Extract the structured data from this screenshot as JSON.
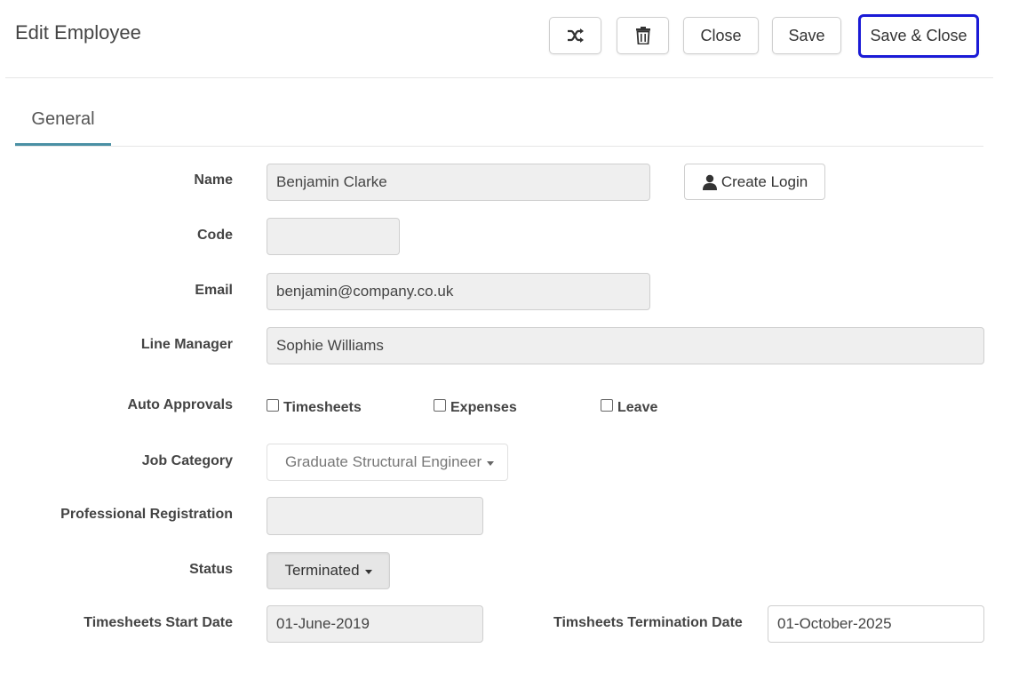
{
  "header": {
    "title": "Edit Employee",
    "buttons": {
      "shuffle_icon": "shuffle-icon",
      "delete_icon": "trash-icon",
      "close": "Close",
      "save": "Save",
      "save_close": "Save & Close"
    },
    "accent_color": "#1a1ad6"
  },
  "tabs": [
    {
      "label": "General",
      "active": true
    }
  ],
  "tab_accent_color": "#4a90a4",
  "form": {
    "name": {
      "label": "Name",
      "value": "Benjamin Clarke"
    },
    "create_login": {
      "label": "Create Login",
      "icon": "user-icon"
    },
    "code": {
      "label": "Code",
      "value": ""
    },
    "email": {
      "label": "Email",
      "value": "benjamin@company.co.uk"
    },
    "line_manager": {
      "label": "Line Manager",
      "value": "Sophie Williams"
    },
    "auto_approvals": {
      "label": "Auto Approvals",
      "options": [
        {
          "label": "Timesheets",
          "checked": false
        },
        {
          "label": "Expenses",
          "checked": false
        },
        {
          "label": "Leave",
          "checked": false
        }
      ]
    },
    "job_category": {
      "label": "Job Category",
      "value": "Graduate Structural Engineer"
    },
    "professional_registration": {
      "label": "Professional Registration",
      "value": ""
    },
    "status": {
      "label": "Status",
      "value": "Terminated"
    },
    "timesheets_start_date": {
      "label": "Timesheets Start Date",
      "value": "01-June-2019"
    },
    "timesheets_termination_date": {
      "label": "Timsheets Termination Date",
      "value": "01-October-2025"
    }
  }
}
